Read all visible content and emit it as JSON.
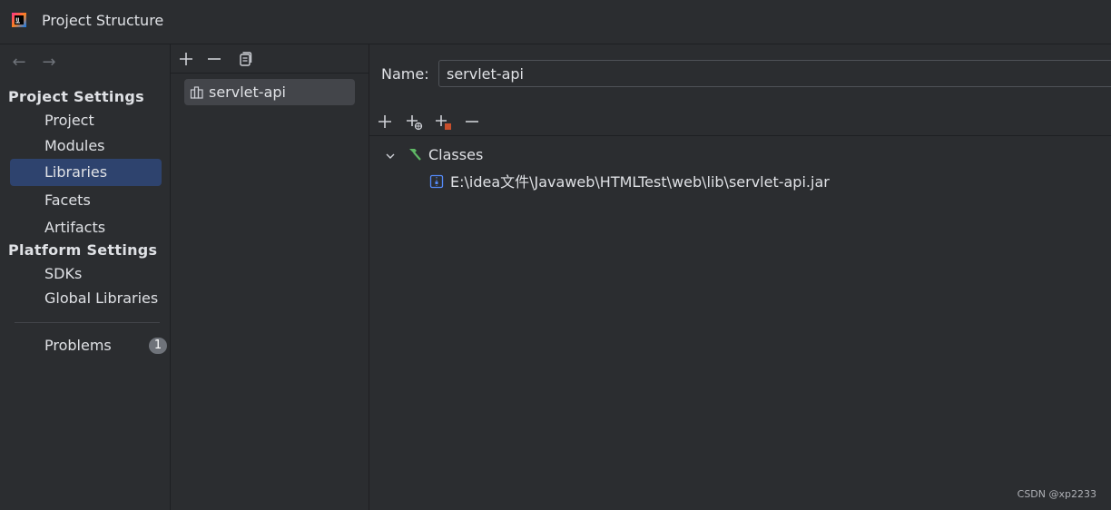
{
  "window": {
    "title": "Project Structure"
  },
  "nav": {
    "back_icon": "arrow-left-icon",
    "forward_icon": "arrow-right-icon",
    "project_settings_header": "Project Settings",
    "project_settings_items": [
      {
        "label": "Project",
        "selected": false
      },
      {
        "label": "Modules",
        "selected": false
      },
      {
        "label": "Libraries",
        "selected": true
      },
      {
        "label": "Facets",
        "selected": false
      },
      {
        "label": "Artifacts",
        "selected": false
      }
    ],
    "platform_settings_header": "Platform Settings",
    "platform_settings_items": [
      {
        "label": "SDKs"
      },
      {
        "label": "Global Libraries"
      }
    ],
    "problems": {
      "label": "Problems",
      "count": "1"
    }
  },
  "libraries": {
    "toolbar": [
      "add-icon",
      "remove-icon",
      "copy-icon"
    ],
    "items": [
      {
        "label": "servlet-api",
        "selected": true
      }
    ]
  },
  "detail": {
    "name_label": "Name:",
    "name_value": "servlet-api",
    "toolbar": [
      "add-icon",
      "add-url-icon",
      "add-jar-icon",
      "remove-icon"
    ],
    "tree": {
      "root_label": "Classes",
      "children": [
        {
          "label": "E:\\idea文件\\Javaweb\\HTMLTest\\web\\lib\\servlet-api.jar"
        }
      ]
    }
  },
  "colors": {
    "background": "#2b2d30",
    "selection": "#2e436e",
    "text": "#dfe1e5",
    "border": "#1e1f22"
  },
  "watermark": "CSDN @xp2233"
}
